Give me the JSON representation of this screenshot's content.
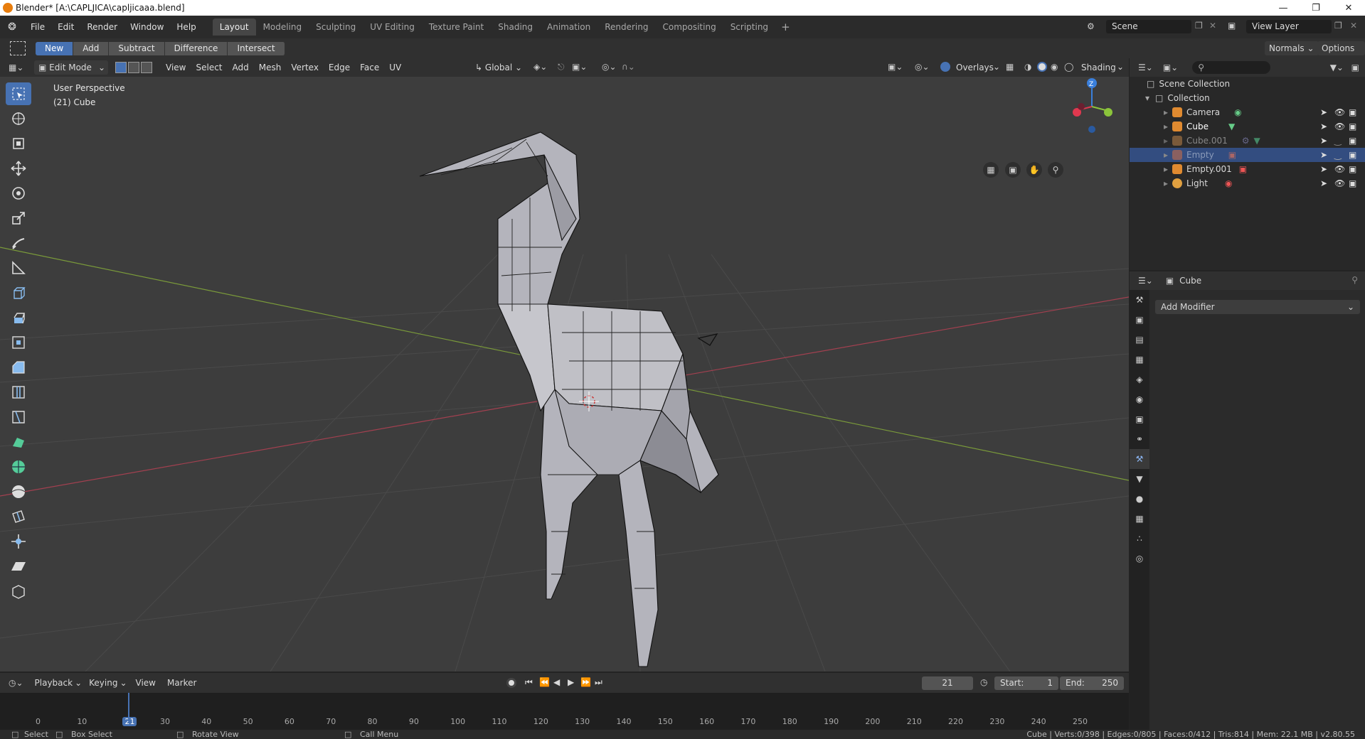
{
  "window": {
    "title": "Blender* [A:\\CAPLJICA\\capljicaaa.blend]"
  },
  "menu": {
    "items": [
      "File",
      "Edit",
      "Render",
      "Window",
      "Help"
    ]
  },
  "workspaces": [
    "Layout",
    "Modeling",
    "Sculpting",
    "UV Editing",
    "Texture Paint",
    "Shading",
    "Animation",
    "Rendering",
    "Compositing",
    "Scripting"
  ],
  "workspace_active": "Layout",
  "scene": {
    "name": "Scene",
    "view_layer": "View Layer"
  },
  "tool_settings": {
    "buttons": [
      "New",
      "Add",
      "Subtract",
      "Difference",
      "Intersect"
    ],
    "active": "New",
    "normals": "Normals",
    "options": "Options"
  },
  "viewport_header": {
    "mode": "Edit Mode",
    "menus": [
      "View",
      "Select",
      "Add",
      "Mesh",
      "Vertex",
      "Edge",
      "Face",
      "UV"
    ],
    "orientation": "Global",
    "overlays": "Overlays",
    "shading": "Shading"
  },
  "viewport": {
    "perspective": "User Perspective",
    "object_info": "(21) Cube",
    "gizmo_axis": "Z"
  },
  "outliner": {
    "root": "Scene Collection",
    "collection": "Collection",
    "items": [
      {
        "name": "Camera",
        "icon": "camera-icon",
        "dim": false,
        "selected": false
      },
      {
        "name": "Cube",
        "icon": "mesh-icon",
        "dim": false,
        "selected": false
      },
      {
        "name": "Cube.001",
        "icon": "mesh-icon",
        "dim": true,
        "selected": false
      },
      {
        "name": "Empty",
        "icon": "image-empty-icon",
        "dim": true,
        "selected": true
      },
      {
        "name": "Empty.001",
        "icon": "image-empty-icon",
        "dim": false,
        "selected": false
      },
      {
        "name": "Light",
        "icon": "light-icon",
        "dim": false,
        "selected": false
      }
    ]
  },
  "properties": {
    "object": "Cube",
    "add_modifier": "Add Modifier"
  },
  "timeline": {
    "menus": [
      "Playback",
      "Keying",
      "View",
      "Marker"
    ],
    "current_frame": "21",
    "start_label": "Start:",
    "start": "1",
    "end_label": "End:",
    "end": "250",
    "ruler": [
      "0",
      "10",
      "21",
      "30",
      "40",
      "50",
      "60",
      "70",
      "80",
      "90",
      "100",
      "110",
      "120",
      "130",
      "140",
      "150",
      "160",
      "170",
      "180",
      "190",
      "200",
      "210",
      "220",
      "230",
      "240",
      "250"
    ]
  },
  "status": {
    "select": "Select",
    "box_select": "Box Select",
    "rotate_view": "Rotate View",
    "call_menu": "Call Menu",
    "stats": "Cube | Verts:0/398 | Edges:0/805 | Faces:0/412 | Tris:814 | Mem: 22.1 MB | v2.80.55"
  },
  "colors": {
    "accent": "#4772b3",
    "x_axis": "#e0384f",
    "y_axis": "#8bc43b",
    "z_axis": "#3a7fdb"
  }
}
